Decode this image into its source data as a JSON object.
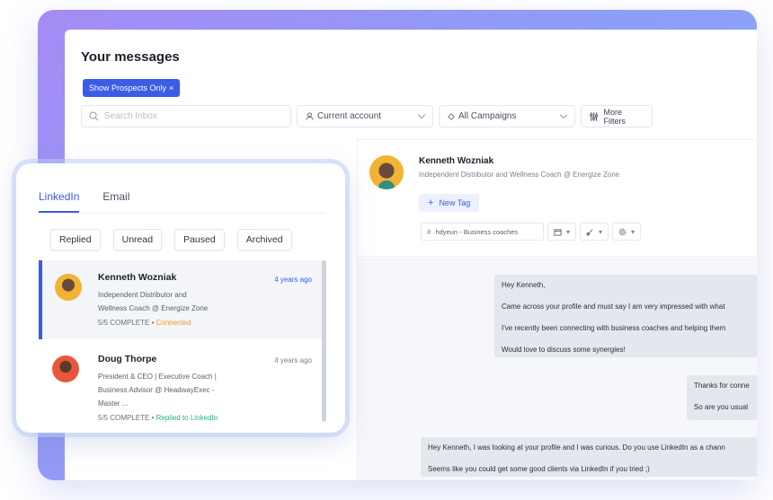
{
  "page": {
    "title": "Your messages"
  },
  "chip": {
    "label": "Show Prospects Only",
    "close": "×"
  },
  "filters": {
    "search_placeholder": "Search Inbox",
    "account": "Current account",
    "campaigns": "All Campaigns",
    "more": "More Filters"
  },
  "detail": {
    "name": "Kenneth Wozniak",
    "subtitle": "Independent Distributor and Wellness Coach @ Energize Zone",
    "new_tag": "New Tag",
    "tag_text": "hdyeun - Business coaches",
    "messages": [
      {
        "lines": [
          "Hey Kenneth,",
          "Came across your profile and must say I am very impressed with what",
          "I've recently been connecting with business coaches and helping them",
          "Would love to discuss some synergies!"
        ]
      },
      {
        "lines": [
          "Thanks for conne",
          "So are you usual"
        ]
      },
      {
        "lines": [
          "Hey Kenneth, I was looking at your profile and I was curious. Do you use LinkedIn as a chann",
          "Seems like you could get some good clients via LinkedIn if you tried ;)"
        ]
      }
    ]
  },
  "card": {
    "tabs": [
      "LinkedIn",
      "Email"
    ],
    "filter_buttons": [
      "Replied",
      "Unread",
      "Paused",
      "Archived"
    ],
    "rows": [
      {
        "name": "Kenneth Wozniak",
        "subtitle_lines": [
          "Independent Distributor and",
          "Wellness Coach @ Energize Zone"
        ],
        "complete": "5/5 COMPLETE",
        "status": "Connected",
        "time": "4 years ago"
      },
      {
        "name": "Doug Thorpe",
        "subtitle_lines": [
          "President & CEO | Executive Coach |",
          "Business Advisor @ HeadwayExec -",
          "Master ..."
        ],
        "complete": "5/5 COMPLETE",
        "status": "Replied to LinkedIn",
        "time": "4 years ago"
      }
    ]
  },
  "colors": {
    "accent": "#3b5ce6",
    "connected": "#f09a2a",
    "replied": "#2bb07a"
  },
  "icons": [
    "search-icon",
    "user-icon",
    "diamond-icon",
    "sliders-icon",
    "plus-icon",
    "hash-icon",
    "calendar-icon",
    "link-icon",
    "gear-icon",
    "chevron-down-icon"
  ]
}
